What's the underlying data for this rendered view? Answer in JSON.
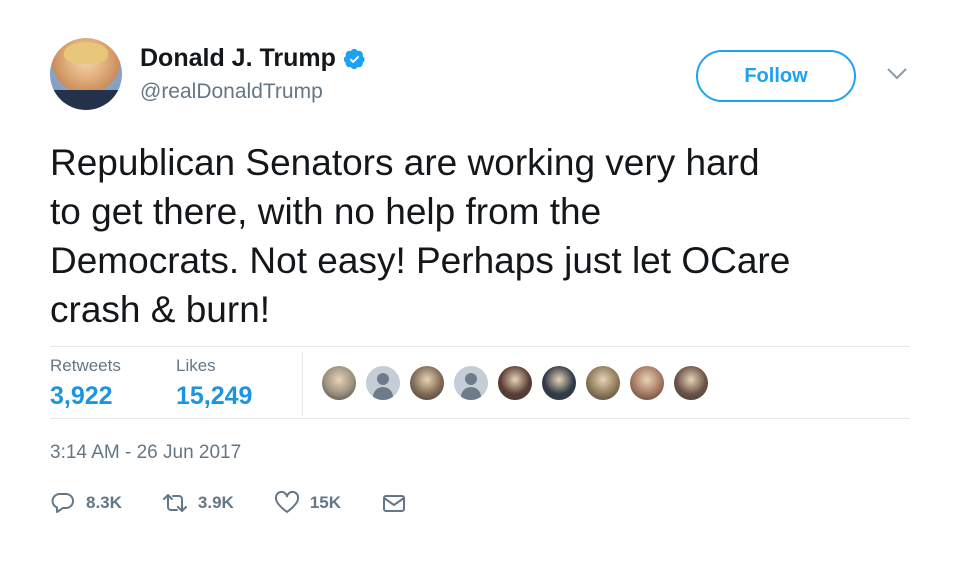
{
  "user": {
    "display_name": "Donald J. Trump",
    "handle": "@realDonaldTrump",
    "verified": true
  },
  "follow_label": "Follow",
  "text_lines": [
    "Republican Senators are working very hard",
    "to get there, with no help from the",
    "Democrats. Not easy! Perhaps just let OCare",
    "crash & burn!"
  ],
  "stats": {
    "retweets_label": "Retweets",
    "retweets_value": "3,922",
    "likes_label": "Likes",
    "likes_value": "15,249"
  },
  "likers": [
    {
      "icon": "liker-photo-avatar",
      "color": "#9a8f7d"
    },
    {
      "icon": "default-user-avatar",
      "color": "#c5ced6"
    },
    {
      "icon": "liker-photo-avatar",
      "color": "#7e6a55"
    },
    {
      "icon": "default-user-avatar",
      "color": "#c5ced6"
    },
    {
      "icon": "liker-photo-avatar",
      "color": "#5a3d36"
    },
    {
      "icon": "liker-photo-avatar",
      "color": "#2f3b45"
    },
    {
      "icon": "liker-photo-avatar",
      "color": "#8c7a58"
    },
    {
      "icon": "liker-photo-avatar",
      "color": "#a47760"
    },
    {
      "icon": "liker-photo-avatar",
      "color": "#6b5447"
    }
  ],
  "timestamp": "3:14 AM - 26 Jun 2017",
  "actions": {
    "reply_count": "8.3K",
    "retweet_count": "3.9K",
    "like_count": "15K"
  },
  "colors": {
    "accent": "#1da1f2",
    "link": "#1b95e0",
    "muted": "#657786",
    "text": "#14171a"
  }
}
